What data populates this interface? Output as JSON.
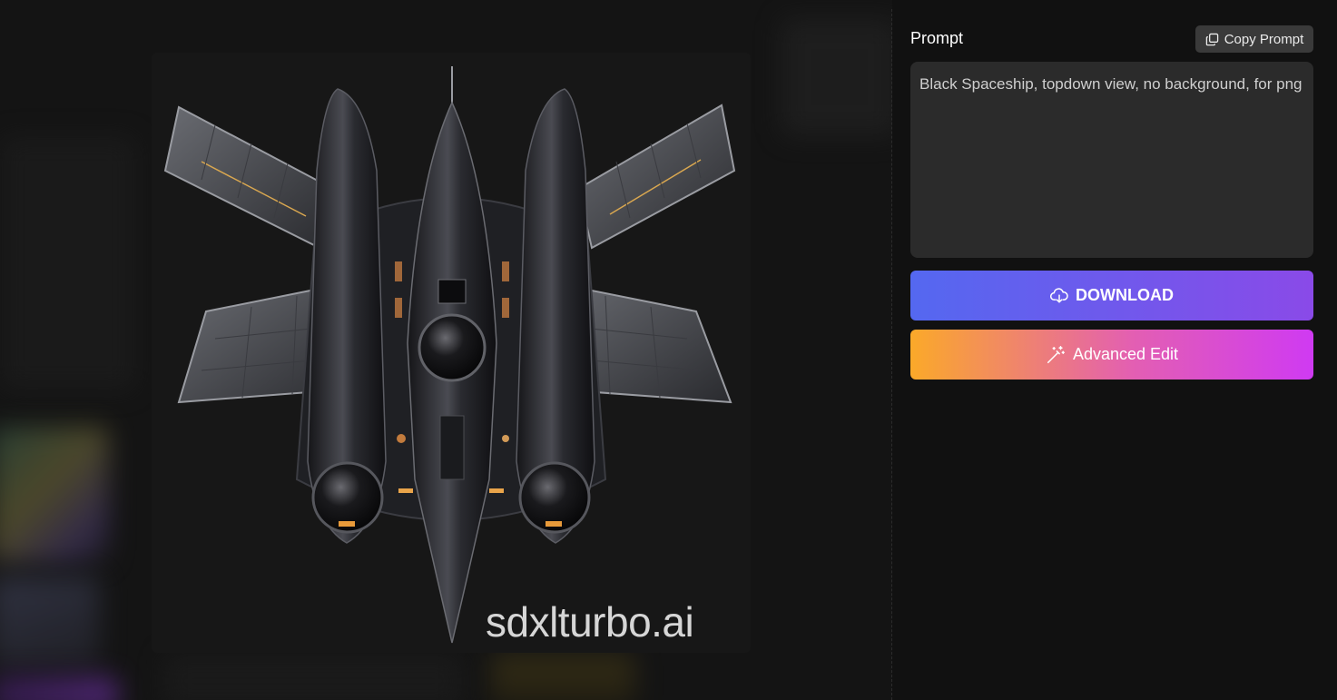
{
  "image": {
    "alt": "",
    "watermark": "sdxlturbo.ai"
  },
  "panel": {
    "prompt_title": "Prompt",
    "copy_prompt_label": "Copy Prompt",
    "copy_icon": "copy-icon",
    "prompt_text": "Black Spaceship, topdown view, no background, for png",
    "download_label": "DOWNLOAD",
    "download_icon": "cloud-download-icon",
    "advanced_edit_label": "Advanced Edit",
    "advanced_edit_icon": "magic-wand-icon"
  },
  "colors": {
    "background": "#101010",
    "prompt_box": "#2b2b2b",
    "download_gradient": [
      "#5468f0",
      "#8a4ae8"
    ],
    "edit_gradient": [
      "#fba929",
      "#e35fb2",
      "#cf3af2"
    ]
  }
}
